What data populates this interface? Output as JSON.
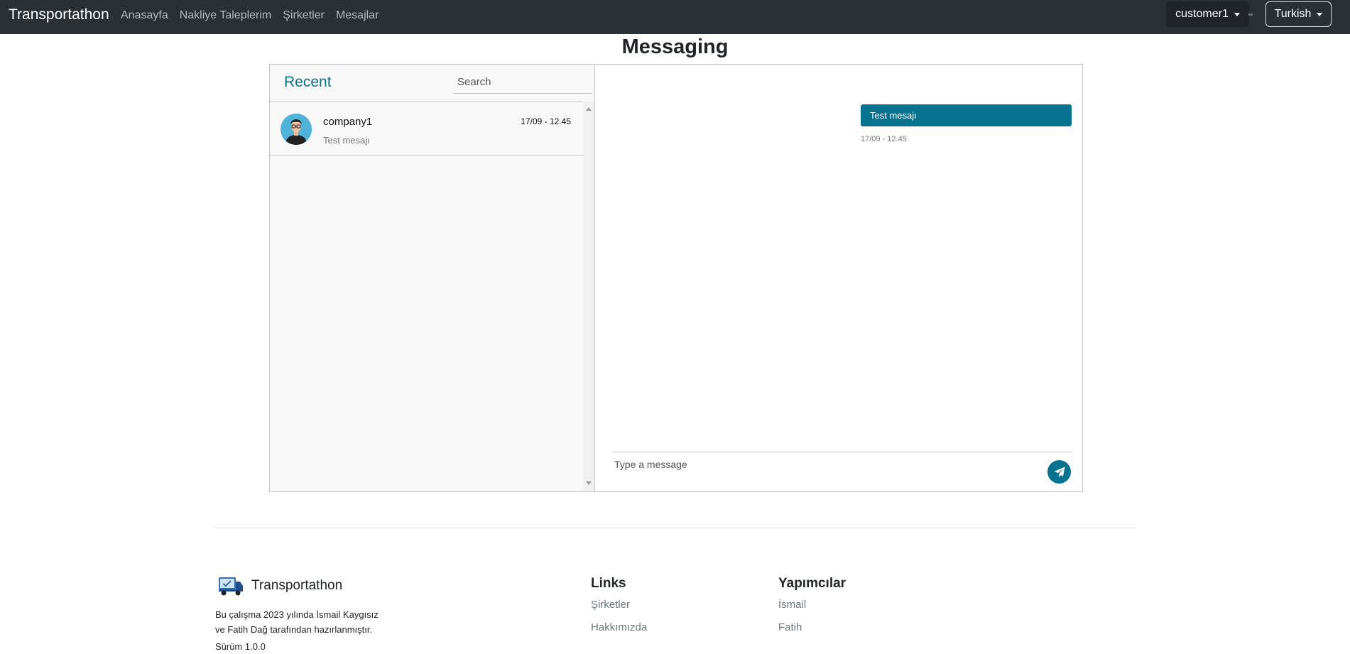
{
  "navbar": {
    "brand": "Transportathon",
    "links": [
      "Anasayfa",
      "Nakliye Taleplerim",
      "Şirketler",
      "Mesajlar"
    ],
    "user_menu": "customer1",
    "language_menu": "Turkish"
  },
  "page": {
    "title": "Messaging"
  },
  "inbox": {
    "heading": "Recent",
    "search_placeholder": "Search",
    "chats": [
      {
        "name": "company1",
        "date": "17/09 - 12.45",
        "preview": "Test mesajı"
      }
    ]
  },
  "conversation": {
    "messages": [
      {
        "text": "Test mesajı",
        "time": "17/09 - 12.45"
      }
    ],
    "input_placeholder": "Type a message"
  },
  "footer": {
    "brand": "Transportathon",
    "description_line1": "Bu çalışma 2023 yılında İsmail Kaygısız",
    "description_line2": "ve Fatih Dağ tarafından hazırlanmıştır.",
    "version": "Sürüm 1.0.0",
    "links_title": "Links",
    "links": [
      "Şirketler",
      "Hakkımızda"
    ],
    "makers_title": "Yapımcılar",
    "makers": [
      "İsmail",
      "Fatih"
    ]
  },
  "colors": {
    "navbar": "#2b3035",
    "accent": "#05728f"
  }
}
